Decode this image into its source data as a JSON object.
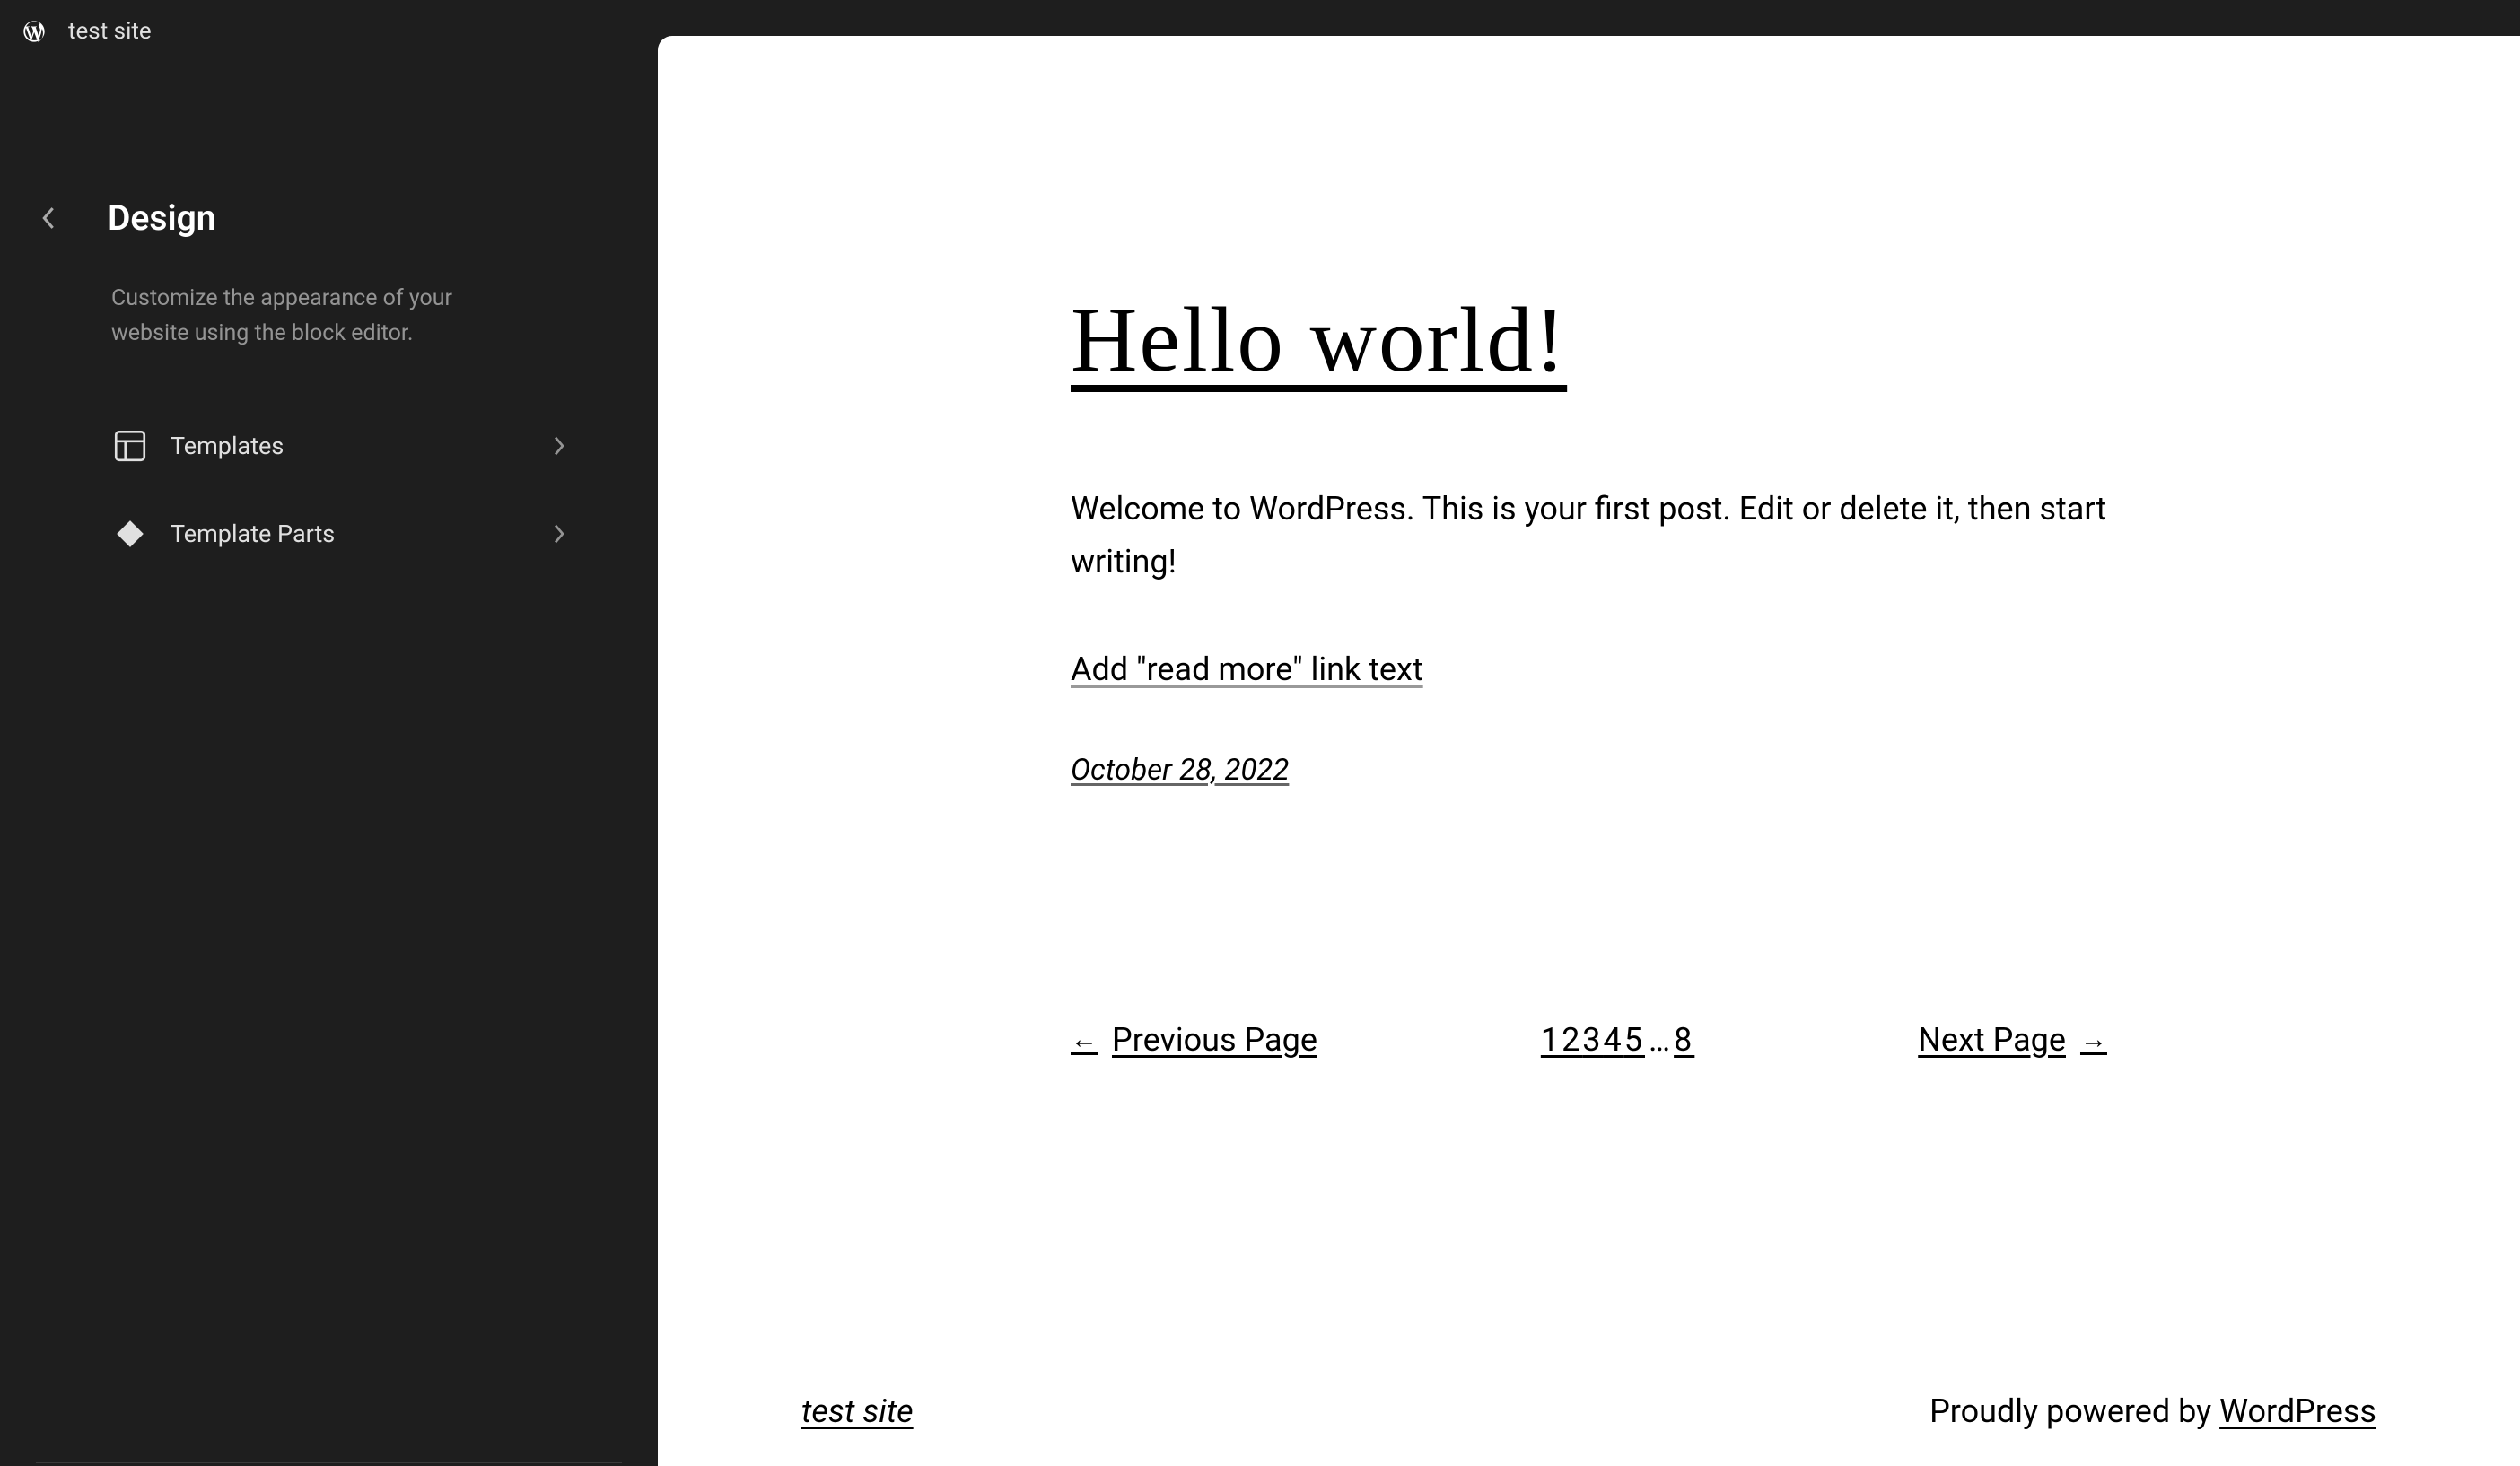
{
  "header": {
    "site_name": "test site"
  },
  "sidebar": {
    "section_title": "Design",
    "section_description": "Customize the appearance of your website using the block editor.",
    "nav_items": [
      {
        "label": "Templates",
        "icon": "layout-icon"
      },
      {
        "label": "Template Parts",
        "icon": "diamond-icon"
      }
    ]
  },
  "preview": {
    "post_title": "Hello world!",
    "post_content": "Welcome to WordPress. This is your first post. Edit or delete it, then start writing!",
    "read_more": "Add \"read more\" link text",
    "post_date": "October 28, 2022",
    "pagination": {
      "prev_label": "Previous Page",
      "next_label": "Next Page",
      "pages": [
        "1",
        "2",
        "3",
        "4",
        "5"
      ],
      "ellipsis": "…",
      "last_page": "8"
    },
    "footer": {
      "site_name": "test site",
      "credit_prefix": "Proudly powered by ",
      "credit_link": "WordPress"
    }
  }
}
